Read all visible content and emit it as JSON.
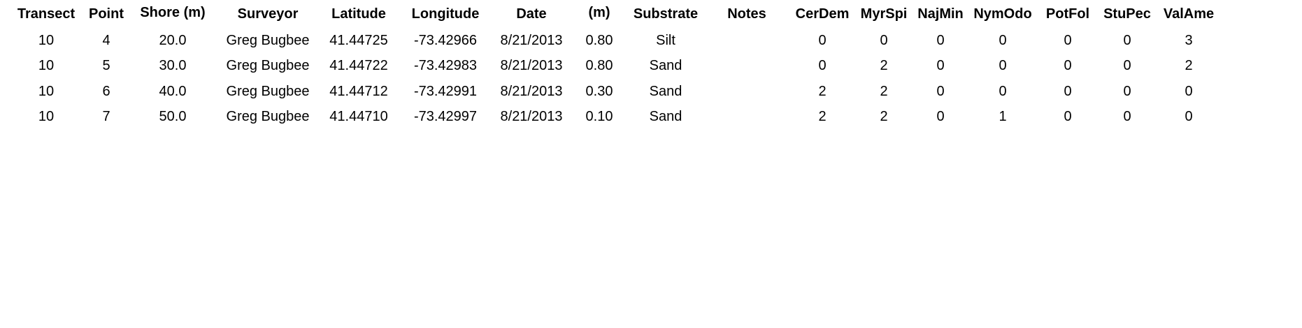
{
  "table": {
    "headers": [
      "Transect",
      "Point",
      "Shore (m)",
      "Surveyor",
      "Latitude",
      "Longitude",
      "Date",
      "(m)",
      "Substrate",
      "Notes",
      "CerDem",
      "MyrSpi",
      "NajMin",
      "NymOdo",
      "PotFol",
      "StuPec",
      "ValAme"
    ],
    "rows": [
      [
        "10",
        "4",
        "20.0",
        "Greg Bugbee",
        "41.44725",
        "-73.42966",
        "8/21/2013",
        "0.80",
        "Silt",
        "",
        "0",
        "0",
        "0",
        "0",
        "0",
        "0",
        "3"
      ],
      [
        "10",
        "5",
        "30.0",
        "Greg Bugbee",
        "41.44722",
        "-73.42983",
        "8/21/2013",
        "0.80",
        "Sand",
        "",
        "0",
        "2",
        "0",
        "0",
        "0",
        "0",
        "2"
      ],
      [
        "10",
        "6",
        "40.0",
        "Greg Bugbee",
        "41.44712",
        "-73.42991",
        "8/21/2013",
        "0.30",
        "Sand",
        "",
        "2",
        "2",
        "0",
        "0",
        "0",
        "0",
        "0"
      ],
      [
        "10",
        "7",
        "50.0",
        "Greg Bugbee",
        "41.44710",
        "-73.42997",
        "8/21/2013",
        "0.10",
        "Sand",
        "",
        "2",
        "2",
        "0",
        "1",
        "0",
        "0",
        "0"
      ]
    ]
  }
}
